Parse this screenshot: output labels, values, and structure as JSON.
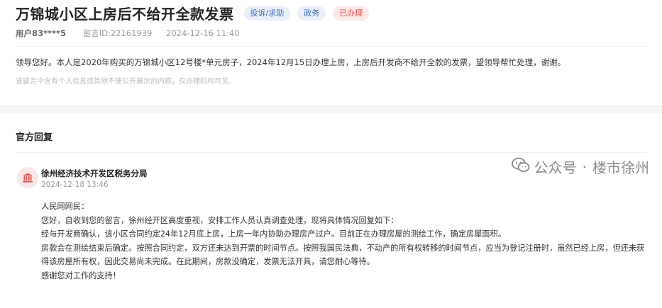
{
  "post": {
    "title": "万锦城小区上房后不给开全款发票",
    "tags": [
      "投诉/求助",
      "政务",
      "已办理"
    ],
    "user": "用户83****5",
    "message_id": "留言ID:22161939",
    "time": "2024-12-16 11:40",
    "content": "领导您好。本人是2020年购买的万锦城小区12号楼*单元房子，2024年12月15日办理上房，上房后开发商不给开全款的发票，望领导帮忙处理，谢谢。",
    "privacy_note": "该留言中含有个人信息或其他不便公开展示的内容，仅办理机构可见。"
  },
  "reply": {
    "section_title": "官方回复",
    "org_icon": "government-building-icon",
    "org_name": "徐州经济技术开发区税务分局",
    "time": "2024-12-18 13:46",
    "lines": [
      "人民网网民：",
      "您好，自收到您的留言，徐州经开区高度重视，安排工作人员认真调查处理，现将具体情况回复如下：",
      "经与开发商确认，该小区合同约定24年12月底上房，上房一年内协助办理房产过户。目前正在办理房屋的测绘工作，确定房屋面积。",
      "房款会在测绘结束后确定。按照合同约定，双方还未达到开票的时间节点。按照我国民法典，不动产的所有权转移的时间节点，应当为登记注册时，虽然已经上房，但还未获",
      "得该房屋所有权，因此交易尚未完成。在此期间，房款没确定，发票无法开具，请您耐心等待。",
      "感谢您对工作的支持！"
    ]
  },
  "watermark": {
    "icon": "wechat-icon",
    "left": "公众号",
    "sep": "·",
    "right": "楼市徐州"
  },
  "colors": {
    "tag_blue_bg": "#e9eef8",
    "tag_blue_text": "#3f6fb7",
    "tag_red_bg": "#fbe8e8",
    "tag_red_text": "#d9534f",
    "org_icon_red": "#d9534f"
  }
}
